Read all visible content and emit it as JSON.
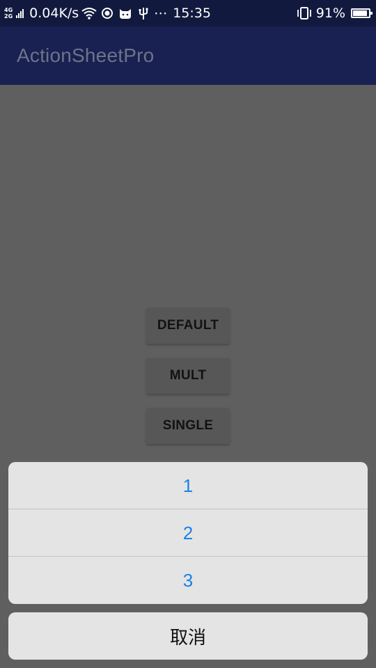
{
  "status_bar": {
    "net_type_top": "4G",
    "net_type_bottom": "2G",
    "speed": "0.04K/s",
    "more": "⋯",
    "time": "15:35",
    "battery_percent": "91%",
    "battery_level": 0.91,
    "icons": [
      "signal-icon",
      "wifi-icon",
      "location-icon",
      "cat-app-icon",
      "usb-icon",
      "vibrate-icon",
      "battery-icon"
    ]
  },
  "app_bar": {
    "title": "ActionSheetPro"
  },
  "buttons": {
    "default_label": "DEFAULT",
    "mult_label": "MULT",
    "single_label": "SINGLE"
  },
  "action_sheet": {
    "items": [
      "1",
      "2",
      "3"
    ],
    "cancel_label": "取消"
  },
  "colors": {
    "status_bar": "#111a3e",
    "app_bar": "#192152",
    "overlay_background": "#5f5f5f",
    "sheet_background": "#e4e4e4",
    "sheet_item_text": "#1a82e6"
  }
}
